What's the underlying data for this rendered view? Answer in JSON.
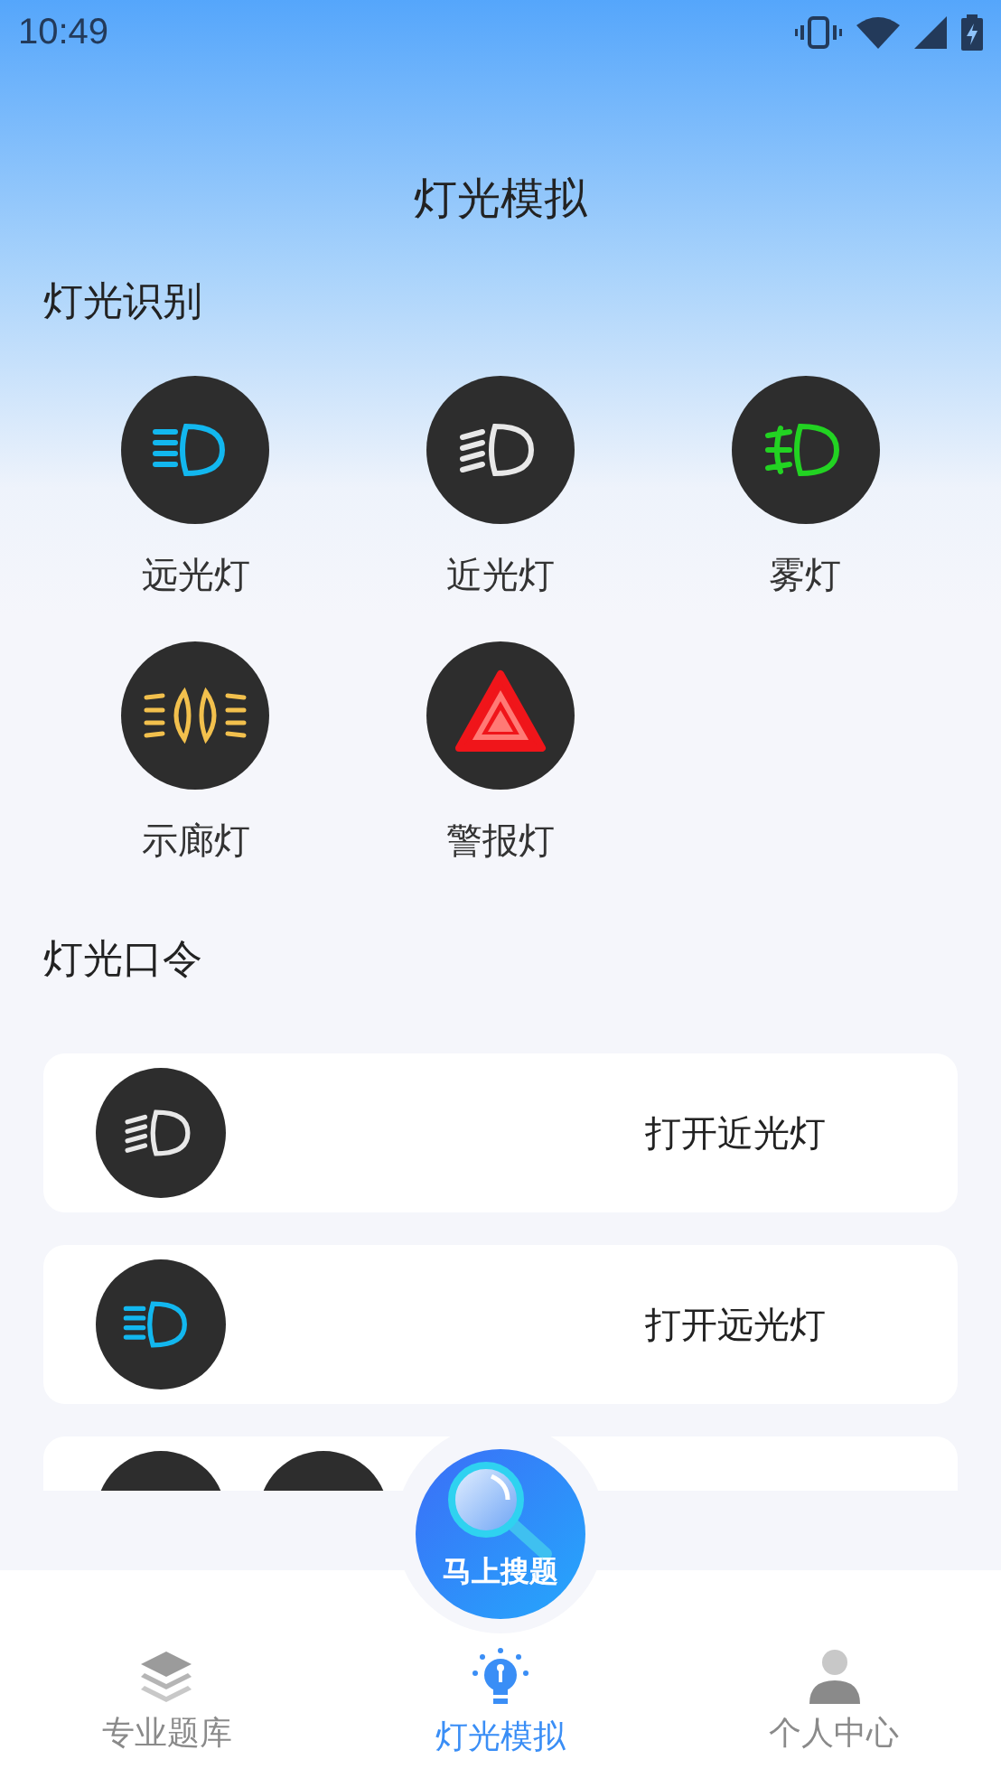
{
  "status_bar": {
    "time": "10:49"
  },
  "title": "灯光模拟",
  "recognition": {
    "heading": "灯光识别",
    "items": [
      {
        "label": "远光灯",
        "kind": "high"
      },
      {
        "label": "近光灯",
        "kind": "low"
      },
      {
        "label": "雾灯",
        "kind": "fog"
      },
      {
        "label": "示廊灯",
        "kind": "position"
      },
      {
        "label": "警报灯",
        "kind": "hazard"
      }
    ]
  },
  "commands": {
    "heading": "灯光口令",
    "items": [
      {
        "text": "打开近光灯",
        "icons": [
          {
            "kind": "low"
          }
        ]
      },
      {
        "text": "打开远光灯",
        "icons": [
          {
            "kind": "high"
          }
        ]
      },
      {
        "icons": [
          {
            "kind": "cut"
          },
          {
            "kind": "cut"
          }
        ]
      }
    ]
  },
  "search_button": {
    "label": "马上搜题"
  },
  "tabs": [
    {
      "label": "专业题库",
      "kind": "layers",
      "selected": false
    },
    {
      "label": "灯光模拟",
      "kind": "bulb",
      "selected": true
    },
    {
      "label": "个人中心",
      "kind": "person",
      "selected": false
    }
  ]
}
